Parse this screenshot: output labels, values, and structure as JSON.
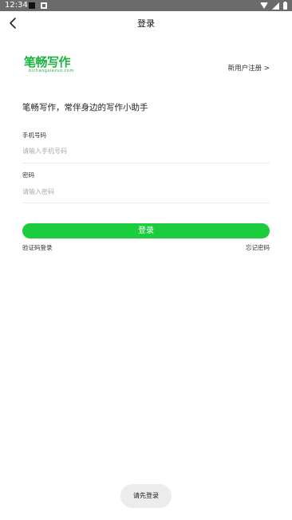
{
  "status_bar": {
    "time": "12:34"
  },
  "header": {
    "title": "登录"
  },
  "logo": {
    "text": "笔畅写作",
    "subtext": "bichangxiezuo.com"
  },
  "register_link": "新用户注册 >",
  "slogan": "笔畅写作，常伴身边的写作小助手",
  "phone_field": {
    "label": "手机号码",
    "placeholder": "请输入手机号码",
    "value": ""
  },
  "password_field": {
    "label": "密码",
    "placeholder": "请输入密码",
    "value": ""
  },
  "login_button": "登录",
  "sms_login": "验证码登录",
  "forgot_password": "忘记密码",
  "toast": "请先登录",
  "colors": {
    "accent": "#1bcc3c",
    "logo": "#18b43d",
    "status_bar": "#6b6b6b"
  },
  "icons": [
    "back-arrow-icon",
    "wifi-icon",
    "signal-icon",
    "battery-icon"
  ]
}
